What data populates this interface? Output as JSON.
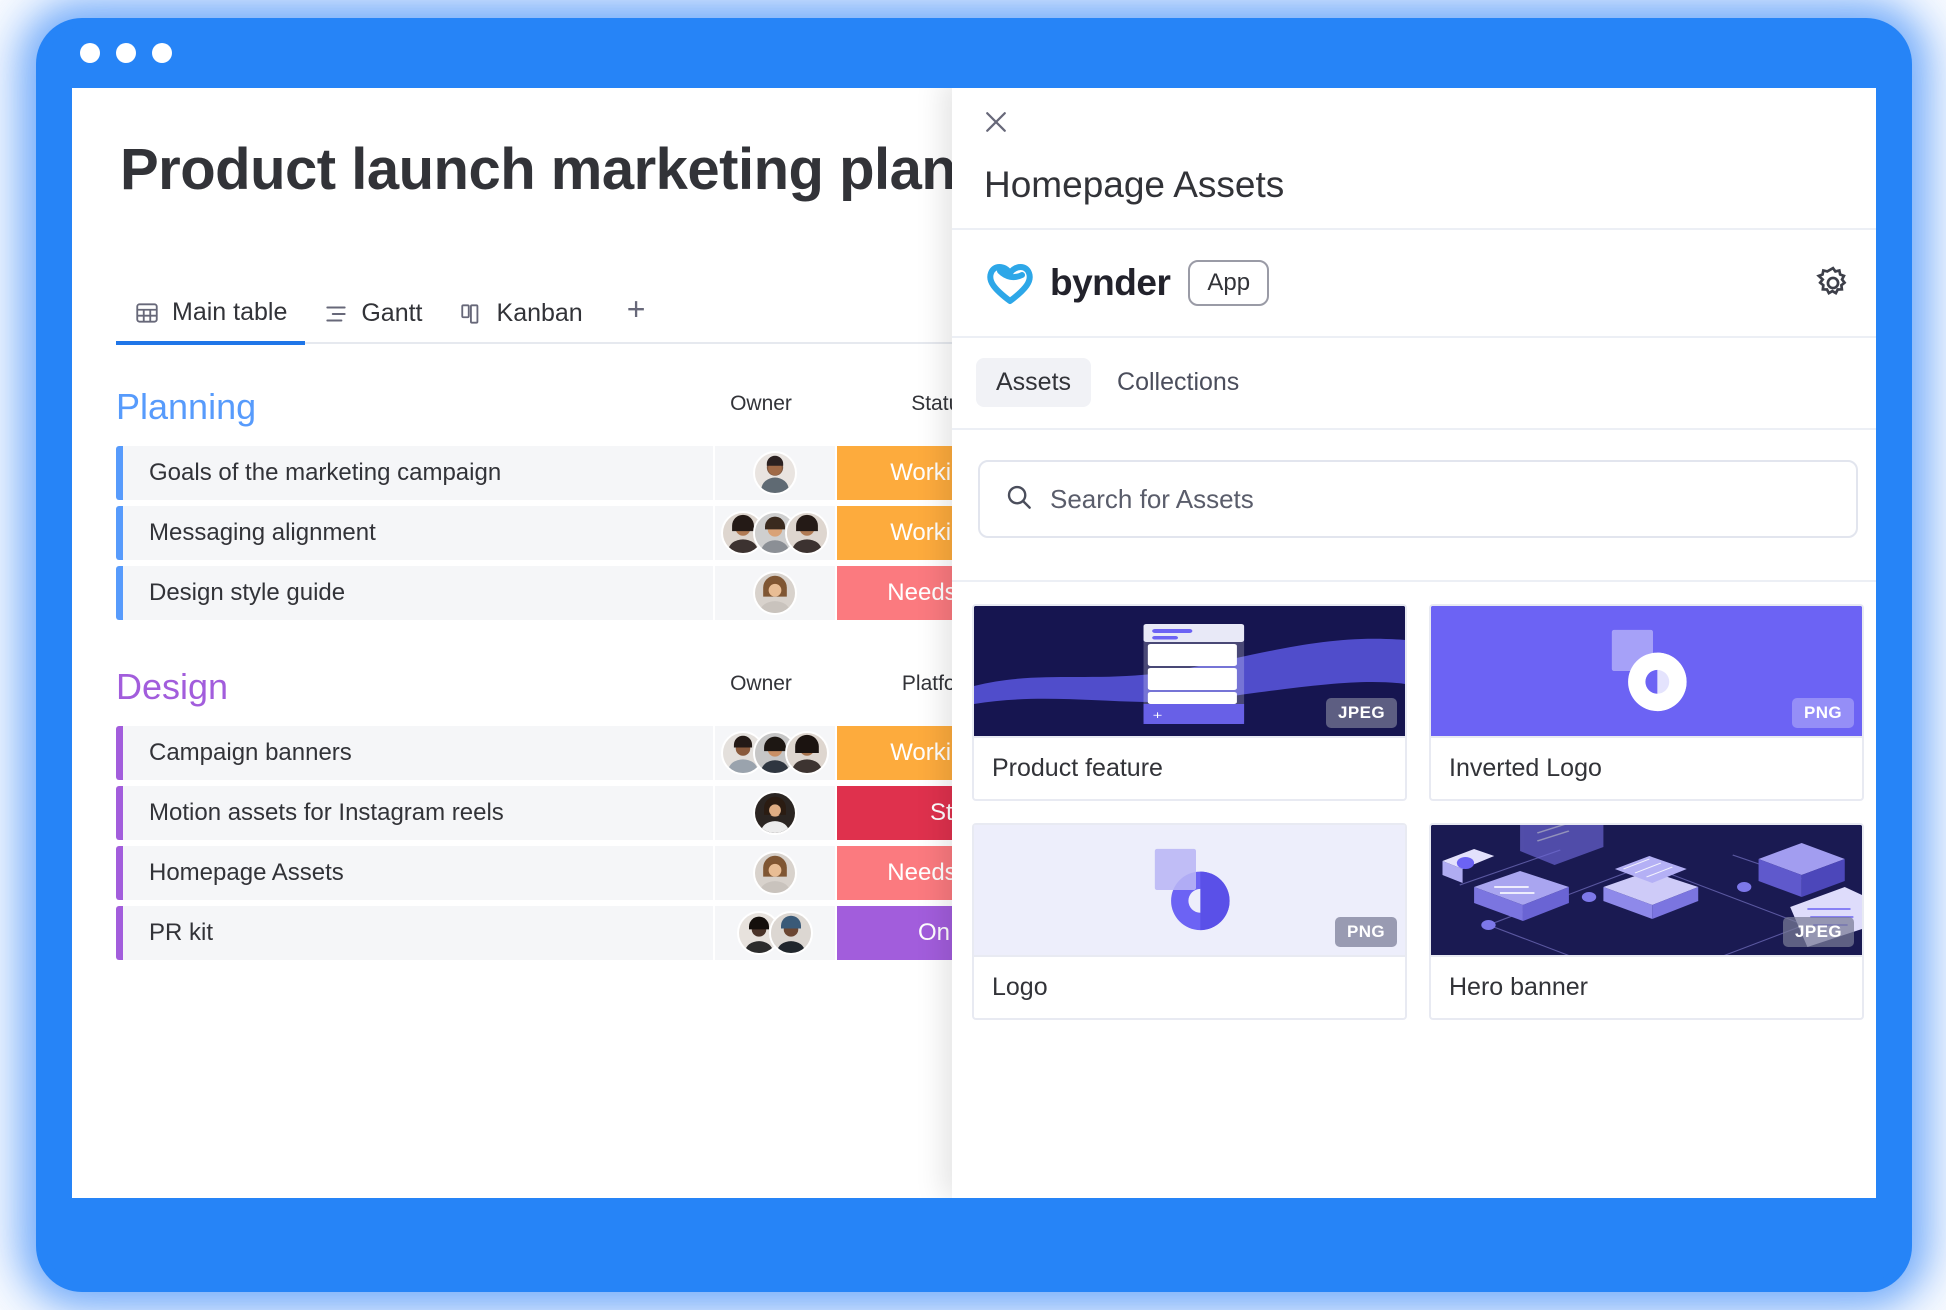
{
  "window": {
    "accent_color": "#2684f7",
    "dots": 3
  },
  "board": {
    "title": "Product launch marketing plan",
    "tabs": [
      {
        "label": "Main table",
        "icon": "table-icon",
        "active": true
      },
      {
        "label": "Gantt",
        "icon": "gantt-icon",
        "active": false
      },
      {
        "label": "Kanban",
        "icon": "kanban-icon",
        "active": false
      }
    ],
    "add_tab_label": "+",
    "groups": [
      {
        "name": "Planning",
        "color": "#579bfc",
        "columns": [
          "Owner",
          "Status"
        ],
        "rows": [
          {
            "name": "Goals of the marketing campaign",
            "owners": 1,
            "status": "Working on it",
            "status_color": "#fdab3d"
          },
          {
            "name": "Messaging alignment",
            "owners": 3,
            "status": "Working on it",
            "status_color": "#fdab3d"
          },
          {
            "name": "Design style guide",
            "owners": 1,
            "status": "Needs review",
            "status_color": "#fb7a7f"
          }
        ]
      },
      {
        "name": "Design",
        "color": "#a25ddc",
        "columns": [
          "Owner",
          "Platform"
        ],
        "rows": [
          {
            "name": "Campaign banners",
            "owners": 3,
            "status": "Working on it",
            "status_color": "#fdab3d"
          },
          {
            "name": "Motion assets for Instagram reels",
            "owners": 1,
            "status": "Stuck",
            "status_color": "#df314d"
          },
          {
            "name": "Homepage Assets",
            "owners": 1,
            "status": "Needs review",
            "status_color": "#fb7a7f"
          },
          {
            "name": "PR kit",
            "owners": 2,
            "status": "On hold",
            "status_color": "#a25ddc"
          }
        ]
      }
    ]
  },
  "panel": {
    "close_icon": "close-icon",
    "title": "Homepage Assets",
    "app": {
      "logo_icon": "bynder-logo-icon",
      "name": "bynder",
      "chip": "App",
      "settings_icon": "gear-icon",
      "logo_color": "#2da7e8"
    },
    "segments": [
      {
        "label": "Assets",
        "selected": true
      },
      {
        "label": "Collections",
        "selected": false
      }
    ],
    "search": {
      "icon": "search-icon",
      "placeholder": "Search for Assets",
      "value": ""
    },
    "assets": [
      {
        "label": "Product feature",
        "format": "JPEG",
        "art": "product-feature"
      },
      {
        "label": "Inverted Logo",
        "format": "PNG",
        "art": "inverted-logo"
      },
      {
        "label": "Logo",
        "format": "PNG",
        "art": "logo"
      },
      {
        "label": "Hero banner",
        "format": "JPEG",
        "art": "hero-banner"
      }
    ]
  }
}
